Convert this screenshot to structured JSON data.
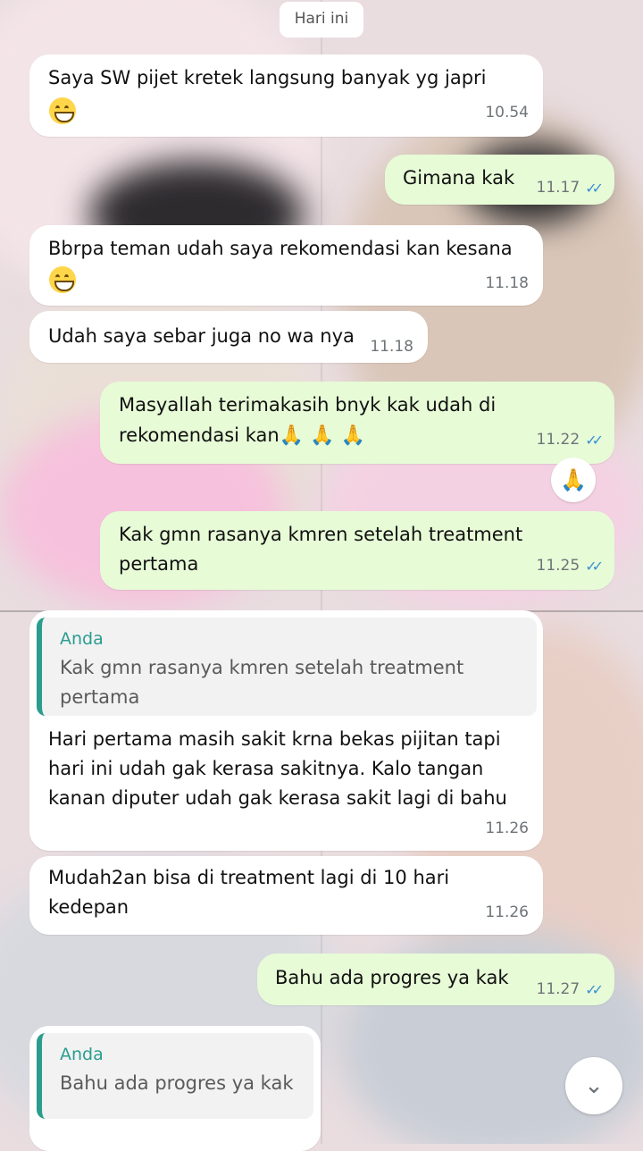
{
  "date_chip": "Hari ini",
  "messages": [
    {
      "id": "m1",
      "text": "Saya SW pijet kretek langsung banyak yg japri",
      "time": "10.54"
    },
    {
      "id": "m2",
      "text": "Gimana kak",
      "time": "11.17"
    },
    {
      "id": "m3",
      "text": "Bbrpa teman udah saya rekomendasi kan kesana",
      "time": "11.18"
    },
    {
      "id": "m4",
      "text": "Udah saya sebar juga no wa nya",
      "time": "11.18"
    },
    {
      "id": "m5",
      "line1": "Masyallah terimakasih bnyk kak udah di",
      "line2": "rekomendasi kan",
      "emojis": "🙏 🙏 🙏",
      "time": "11.22"
    },
    {
      "id": "m6",
      "text": "Kak gmn rasanya kmren setelah treatment\npertama",
      "time": "11.25"
    },
    {
      "id": "m7",
      "quote_author": "Anda",
      "quote_text": "Kak gmn rasanya kmren setelah treatment\npertama",
      "text": "Hari pertama masih sakit krna bekas pijitan tapi\nhari ini udah gak kerasa sakitnya. Kalo tangan\nkanan diputer udah gak kerasa sakit lagi di bahu",
      "time": "11.26"
    },
    {
      "id": "m8",
      "text": "Mudah2an bisa di treatment lagi di 10 hari\nkedepan",
      "time": "11.26"
    },
    {
      "id": "m9",
      "text": "Bahu ada progres ya kak",
      "time": "11.27"
    },
    {
      "id": "m10",
      "quote_author": "Anda",
      "quote_text": "Bahu ada progres ya kak"
    }
  ],
  "reaction": "🙏",
  "icons": {
    "read_receipt": "double-check-icon",
    "scroll": "chevron-double-down-icon",
    "emoji": "grinning-face-icon"
  },
  "colors": {
    "incoming_bubble": "#ffffff",
    "outgoing_bubble": "#e7fbd7",
    "read_tick": "#3b8fd6",
    "quote_accent": "#2a9d8f"
  }
}
